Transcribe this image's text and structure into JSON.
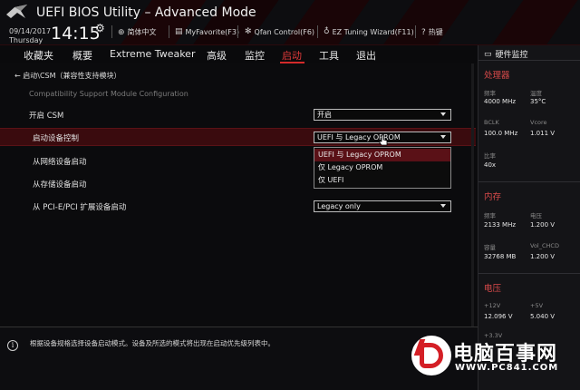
{
  "header": {
    "title": "UEFI BIOS Utility – Advanced Mode",
    "date": "09/14/2017",
    "day": "Thursday",
    "time": "14:15",
    "links": [
      {
        "label": "简体中文",
        "icon": "globe-icon"
      },
      {
        "label": "MyFavorite(F3)",
        "icon": "favorite-icon"
      },
      {
        "label": "Qfan Control(F6)",
        "icon": "fan-icon"
      },
      {
        "label": "EZ Tuning Wizard(F11)",
        "icon": "bulb-icon"
      },
      {
        "label": "热键",
        "icon": "hotkey-icon"
      }
    ]
  },
  "menu": {
    "items": [
      "收藏夹",
      "概要",
      "Extreme Tweaker",
      "高级",
      "监控",
      "启动",
      "工具",
      "退出"
    ],
    "active": "启动"
  },
  "main": {
    "breadcrumb": "启动\\CSM（兼容性支持模块）",
    "subtitle": "Compatibility Support Module Configuration",
    "rows": [
      {
        "label": "开启 CSM",
        "value": "开启"
      },
      {
        "label": "启动设备控制",
        "value": "UEFI 与 Legacy OPROM"
      },
      {
        "label": "从网络设备启动",
        "value": ""
      },
      {
        "label": "从存储设备启动",
        "value": ""
      },
      {
        "label": "从 PCI-E/PCI 扩展设备启动",
        "value": "Legacy only"
      }
    ],
    "dropdown_options": [
      "UEFI 与 Legacy OPROM",
      "仅 Legacy OPROM",
      "仅 UEFI"
    ]
  },
  "monitor": {
    "title": "硬件监控",
    "cpu": {
      "section": "处理器",
      "freq_label": "频率",
      "freq": "4000 MHz",
      "temp_label": "温度",
      "temp": "35°C",
      "bclk_label": "BCLK",
      "bclk": "100.0 MHz",
      "vcore_label": "Vcore",
      "vcore": "1.011 V",
      "ratio_label": "比率",
      "ratio": "40x"
    },
    "memory": {
      "section": "内存",
      "freq_label": "频率",
      "freq": "2133 MHz",
      "volt_label": "电压",
      "volt": "1.200 V",
      "cap_label": "容量",
      "cap": "32768 MB",
      "chcd_label": "Vol_CHCD",
      "chcd": "1.200 V"
    },
    "voltage": {
      "section": "电压",
      "v12_label": "+12V",
      "v12": "12.096 V",
      "v5_label": "+5V",
      "v5": "5.040 V",
      "v33_label": "+3.3V"
    }
  },
  "help": {
    "text": "根据设备规格选择设备启动模式。设备及所选的模式将出现在启动优先级列表中。"
  },
  "watermark": {
    "brand": "电脑百事网",
    "url": "WWW.PC841.COM"
  },
  "colors": {
    "accent": "#d42a2a",
    "highlight_row": "#3a0b0e",
    "selected_option": "#5a1117",
    "background": "#0b0b0d"
  }
}
